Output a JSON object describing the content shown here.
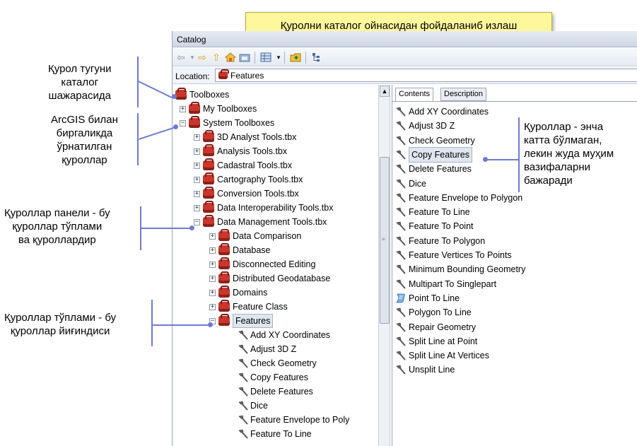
{
  "title_box": {
    "text": "Қуролни каталог ойнасидан фойдаланиб излаш"
  },
  "callouts": {
    "tool_node": [
      "Қурол тугуни",
      "каталог",
      "шажарасида"
    ],
    "arcgis": [
      "ArcGIS билан",
      "биргаликда",
      "ўрнатилган",
      "қуроллар"
    ],
    "toolbar": [
      "Қуроллар панели - бу",
      "қуроллар тўплами",
      "ва қуроллардир"
    ],
    "toolsets": [
      "Қуроллар тўплами - бу",
      "қуроллар йиғиндиси"
    ],
    "right": [
      "Қуроллар - энча",
      "катта бўлмаган,",
      "лекин жуда муҳим",
      "вазифаларни",
      "бажаради"
    ]
  },
  "window": {
    "title": "Catalog",
    "location_label": "Location:",
    "location_value": "Features"
  },
  "tree": [
    {
      "label": "Toolboxes",
      "indent": 0,
      "exp": "",
      "icon": "red"
    },
    {
      "label": "My Toolboxes",
      "indent": 1,
      "exp": "+",
      "icon": "red"
    },
    {
      "label": "System Toolboxes",
      "indent": 1,
      "exp": "−",
      "icon": "red"
    },
    {
      "label": "3D Analyst Tools.tbx",
      "indent": 2,
      "exp": "+",
      "icon": "red"
    },
    {
      "label": "Analysis Tools.tbx",
      "indent": 2,
      "exp": "+",
      "icon": "red"
    },
    {
      "label": "Cadastral Tools.tbx",
      "indent": 2,
      "exp": "+",
      "icon": "red"
    },
    {
      "label": "Cartography Tools.tbx",
      "indent": 2,
      "exp": "+",
      "icon": "red"
    },
    {
      "label": "Conversion Tools.tbx",
      "indent": 2,
      "exp": "+",
      "icon": "red"
    },
    {
      "label": "Data Interoperability Tools.tbx",
      "indent": 2,
      "exp": "+",
      "icon": "red"
    },
    {
      "label": "Data Management Tools.tbx",
      "indent": 2,
      "exp": "−",
      "icon": "red"
    },
    {
      "label": "Data Comparison",
      "indent": 3,
      "exp": "+",
      "icon": "red"
    },
    {
      "label": "Database",
      "indent": 3,
      "exp": "+",
      "icon": "red"
    },
    {
      "label": "Disconnected Editing",
      "indent": 3,
      "exp": "+",
      "icon": "red"
    },
    {
      "label": "Distributed Geodatabase",
      "indent": 3,
      "exp": "+",
      "icon": "red"
    },
    {
      "label": "Domains",
      "indent": 3,
      "exp": "+",
      "icon": "red"
    },
    {
      "label": "Feature Class",
      "indent": 3,
      "exp": "+",
      "icon": "red"
    },
    {
      "label": "Features",
      "indent": 3,
      "exp": "−",
      "icon": "red",
      "selected": true
    },
    {
      "label": "Add XY Coordinates",
      "indent": 4,
      "exp": "",
      "icon": "hammer"
    },
    {
      "label": "Adjust 3D Z",
      "indent": 4,
      "exp": "",
      "icon": "hammer"
    },
    {
      "label": "Check Geometry",
      "indent": 4,
      "exp": "",
      "icon": "hammer"
    },
    {
      "label": "Copy Features",
      "indent": 4,
      "exp": "",
      "icon": "hammer"
    },
    {
      "label": "Delete Features",
      "indent": 4,
      "exp": "",
      "icon": "hammer"
    },
    {
      "label": "Dice",
      "indent": 4,
      "exp": "",
      "icon": "hammer"
    },
    {
      "label": "Feature Envelope to Poly",
      "indent": 4,
      "exp": "",
      "icon": "hammer"
    },
    {
      "label": "Feature To Line",
      "indent": 4,
      "exp": "",
      "icon": "hammer"
    }
  ],
  "tabs": [
    "Contents",
    "Description"
  ],
  "contents": [
    {
      "label": "Add XY Coordinates",
      "icon": "hammer"
    },
    {
      "label": "Adjust 3D Z",
      "icon": "hammer"
    },
    {
      "label": "Check Geometry",
      "icon": "hammer"
    },
    {
      "label": "Copy Features",
      "icon": "hammer",
      "selected": true
    },
    {
      "label": "Delete Features",
      "icon": "hammer"
    },
    {
      "label": "Dice",
      "icon": "hammer"
    },
    {
      "label": "Feature Envelope to Polygon",
      "icon": "hammer"
    },
    {
      "label": "Feature To Line",
      "icon": "hammer"
    },
    {
      "label": "Feature To Point",
      "icon": "hammer"
    },
    {
      "label": "Feature To Polygon",
      "icon": "hammer"
    },
    {
      "label": "Feature Vertices To Points",
      "icon": "hammer"
    },
    {
      "label": "Minimum Bounding Geometry",
      "icon": "hammer"
    },
    {
      "label": "Multipart To Singlepart",
      "icon": "hammer"
    },
    {
      "label": "Point To Line",
      "icon": "script"
    },
    {
      "label": "Polygon To Line",
      "icon": "hammer"
    },
    {
      "label": "Repair Geometry",
      "icon": "hammer"
    },
    {
      "label": "Split Line at Point",
      "icon": "hammer"
    },
    {
      "label": "Split Line At Vertices",
      "icon": "hammer"
    },
    {
      "label": "Unsplit Line",
      "icon": "hammer"
    }
  ],
  "colors": {
    "callout_line": "#6f7bd0",
    "title_box_bg": "#fff79c",
    "toolbox_red": "#c8362c"
  }
}
